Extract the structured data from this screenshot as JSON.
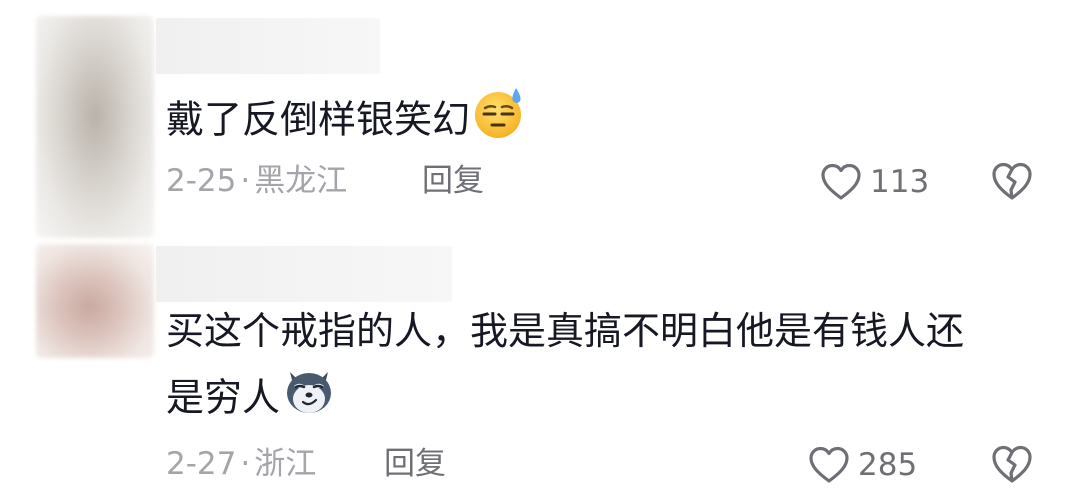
{
  "comments": [
    {
      "text": "戴了反倒样银笑幻",
      "emoji": "sweat-face-emoji",
      "date": "2-25",
      "separator": "·",
      "location": "黑龙江",
      "reply_label": "回复",
      "like_count": "113"
    },
    {
      "text_line1": "买这个戒指的人，我是真搞不明白他是有钱人还",
      "text_line2": "是穷人",
      "emoji": "smug-husky-emoji",
      "date": "2-27",
      "separator": "·",
      "location": "浙江",
      "reply_label": "回复",
      "like_count": "285"
    }
  ],
  "icons": {
    "like": "heart-outline-icon",
    "dislike": "broken-heart-icon"
  },
  "colors": {
    "text": "#161823",
    "meta": "#a4a5aa",
    "action": "#6f7076",
    "emoji_yellow": "#ffc83d",
    "sweat_blue": "#59a8f0"
  }
}
